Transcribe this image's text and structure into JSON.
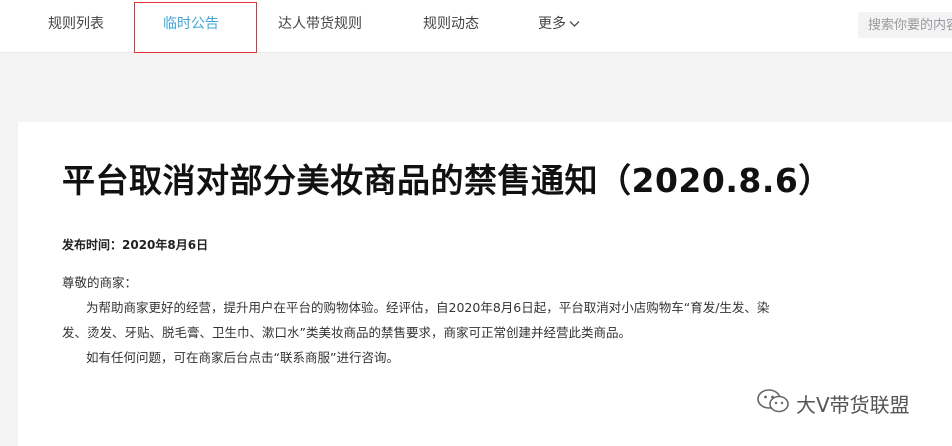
{
  "nav": {
    "items": [
      {
        "label": "规则列表"
      },
      {
        "label": "临时公告"
      },
      {
        "label": "达人带货规则"
      },
      {
        "label": "规则动态"
      },
      {
        "label": "更多"
      }
    ],
    "search_placeholder": "搜索你要的内容"
  },
  "article": {
    "title": "平台取消对部分美妆商品的禁售通知（2020.8.6）",
    "publish_time": "发布时间：2020年8月6日",
    "greeting": "尊敬的商家：",
    "para1_line1": "为帮助商家更好的经营，提升用户在平台的购物体验。经评估，自2020年8月6日起，平台取消对小店购物车“育发/生发、染",
    "para1_line2": "发、烫发、牙贴、脱毛膏、卫生巾、漱口水”类美妆商品的禁售要求，商家可正常创建并经营此类商品。",
    "para2": "如有任何问题，可在商家后台点击“联系商服”进行咨询。"
  },
  "watermark": {
    "text": "大V带货联盟",
    "icon": "wechat-icon"
  },
  "colors": {
    "active_tab": "#3ea6d8",
    "highlight_border": "#e0343a"
  }
}
